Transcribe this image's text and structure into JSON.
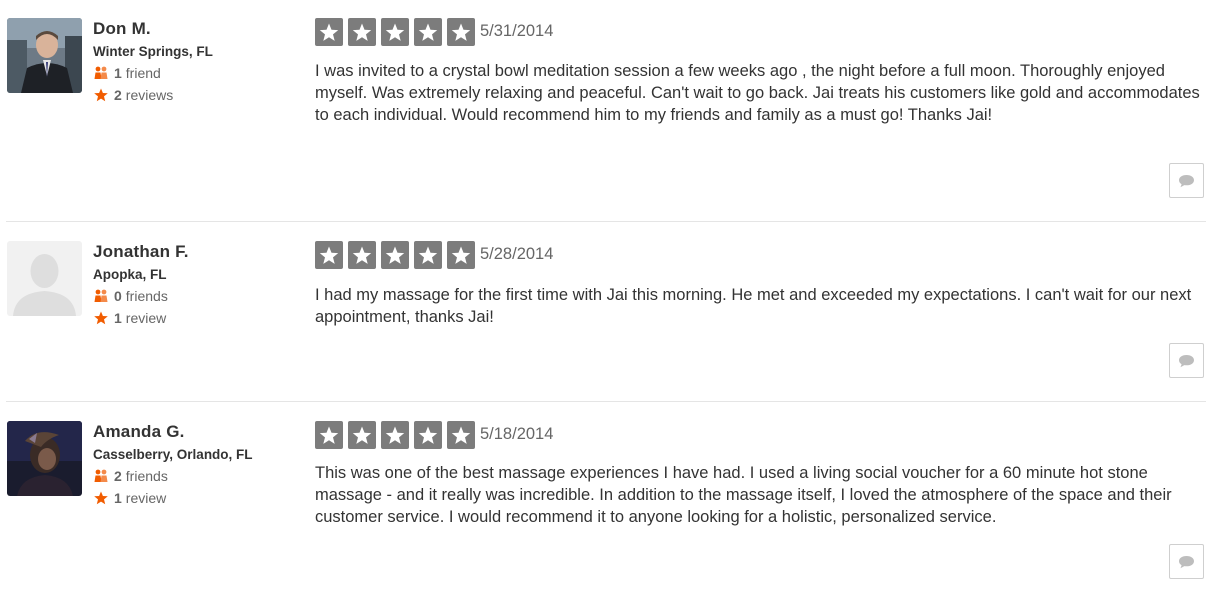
{
  "reviews": [
    {
      "user": {
        "name": "Don M.",
        "location": "Winter Springs, FL",
        "friends_count": "1",
        "friends_label": "friend",
        "reviews_count": "2",
        "reviews_label": "reviews",
        "avatar": "photo-man-in-suit"
      },
      "rating": 5,
      "date": "5/31/2014",
      "text": "I was invited to a crystal bowl meditation session a few weeks ago , the night before a full moon. Thoroughly enjoyed myself. Was extremely relaxing and peaceful. Can't wait to go back. Jai treats his customers like gold and accommodates to each individual. Would recommend him to my friends and family as a must go! Thanks Jai!"
    },
    {
      "user": {
        "name": "Jonathan F.",
        "location": "Apopka, FL",
        "friends_count": "0",
        "friends_label": "friends",
        "reviews_count": "1",
        "reviews_label": "review",
        "avatar": "default-silhouette"
      },
      "rating": 5,
      "date": "5/28/2014",
      "text": "I had my massage for the first time with Jai this morning. He met and exceeded my expectations. I can't wait for our next appointment, thanks Jai!"
    },
    {
      "user": {
        "name": "Amanda G.",
        "location": "Casselberry, Orlando, FL",
        "friends_count": "2",
        "friends_label": "friends",
        "reviews_count": "1",
        "reviews_label": "review",
        "avatar": "photo-dark-portrait"
      },
      "rating": 5,
      "date": "5/18/2014",
      "text": "This was one of the best massage experiences I have had. I used a living social voucher for a 60 minute hot stone massage - and it really was incredible. In addition to the massage itself, I loved the atmosphere of the space and their customer service. I would recommend it to anyone looking for a holistic, personalized service."
    }
  ],
  "icons": {
    "friends": "friends-icon",
    "reviews": "star-icon",
    "comment": "comment-bubble-icon",
    "rating_star": "rating-star-icon"
  },
  "colors": {
    "star_tile": "#7c7c7c",
    "accent_orange": "#f15c00",
    "text": "#333333",
    "muted": "#666666"
  }
}
